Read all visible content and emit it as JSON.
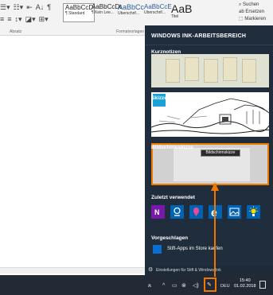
{
  "ribbon": {
    "styles": [
      {
        "sample": "AaBbCcDd",
        "name": "¶ Standard",
        "selected": true
      },
      {
        "sample": "AaBbCcDd",
        "name": "¶ Kein Lee..."
      },
      {
        "sample": "AaBbCc",
        "name": "Überschrif..."
      },
      {
        "sample": "AaBbCcE",
        "name": "Überschrif..."
      },
      {
        "sample": "AaB",
        "name": "Titel"
      }
    ],
    "paragraph_label": "Absatz",
    "styles_label": "Formatvorlagen",
    "search_label": "Suchen",
    "replace_label": "Ersetzen",
    "select_label": "Markieren"
  },
  "ink": {
    "title": "WINDOWS INK-ARBEITSBEREICH",
    "tiles": {
      "sticky_label": "Kurznotizen",
      "sketch_label": "Skizzenblock",
      "screen_label": "Bildschirmskizze",
      "tooltip": "Bildschirmskizze"
    },
    "recent_label": "Zuletzt verwendet",
    "suggested_label": "Vorgeschlagen",
    "store_text": "Stift-Apps im Store kaufen",
    "settings_text": "Einstellungen für Stift & Windows Ink"
  },
  "taskbar": {
    "language": "DEU",
    "time": "15:40",
    "date": "01.02.2018"
  },
  "colors": {
    "accent": "#f07800",
    "panel": "#1f2d3d",
    "taskbar": "#222a35"
  }
}
